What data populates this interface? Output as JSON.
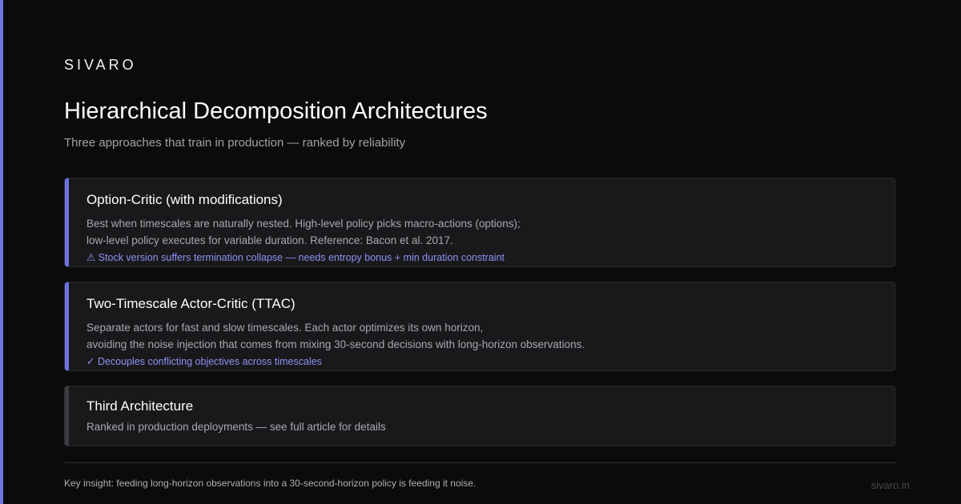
{
  "brand": "SIVARO",
  "title": "Hierarchical Decomposition Architectures",
  "subtitle": "Three approaches that train in production — ranked by reliability",
  "cards": [
    {
      "title": "Option-Critic (with modifications)",
      "desc_lines": [
        "Best when timescales are naturally nested. High-level policy picks macro-actions (options);",
        "low-level policy executes for variable duration. Reference: Bacon et al. 2017."
      ],
      "note": "⚠ Stock version suffers termination collapse — needs entropy bonus + min duration constraint",
      "accent": "#6f73e6"
    },
    {
      "title": "Two-Timescale Actor-Critic (TTAC)",
      "desc_lines": [
        "Separate actors for fast and slow timescales. Each actor optimizes its own horizon,",
        "avoiding the noise injection that comes from mixing 30-second decisions with long-horizon observations."
      ],
      "note": "✓ Decouples conflicting objectives across timescales",
      "accent": "#6f73e6"
    },
    {
      "title": "Third Architecture",
      "desc_lines": [
        "Ranked in production deployments — see full article for details"
      ],
      "accent": "#3b3b40"
    }
  ],
  "footer": {
    "insight": "Key insight: feeding long-horizon observations into a 30-second-horizon policy is feeding it noise.",
    "domain": "sivaro.in"
  },
  "colors": {
    "background": "#0b0b0c",
    "accent": "#6f73e6",
    "card_background": "#19191c",
    "note_text": "#8e91f0"
  }
}
